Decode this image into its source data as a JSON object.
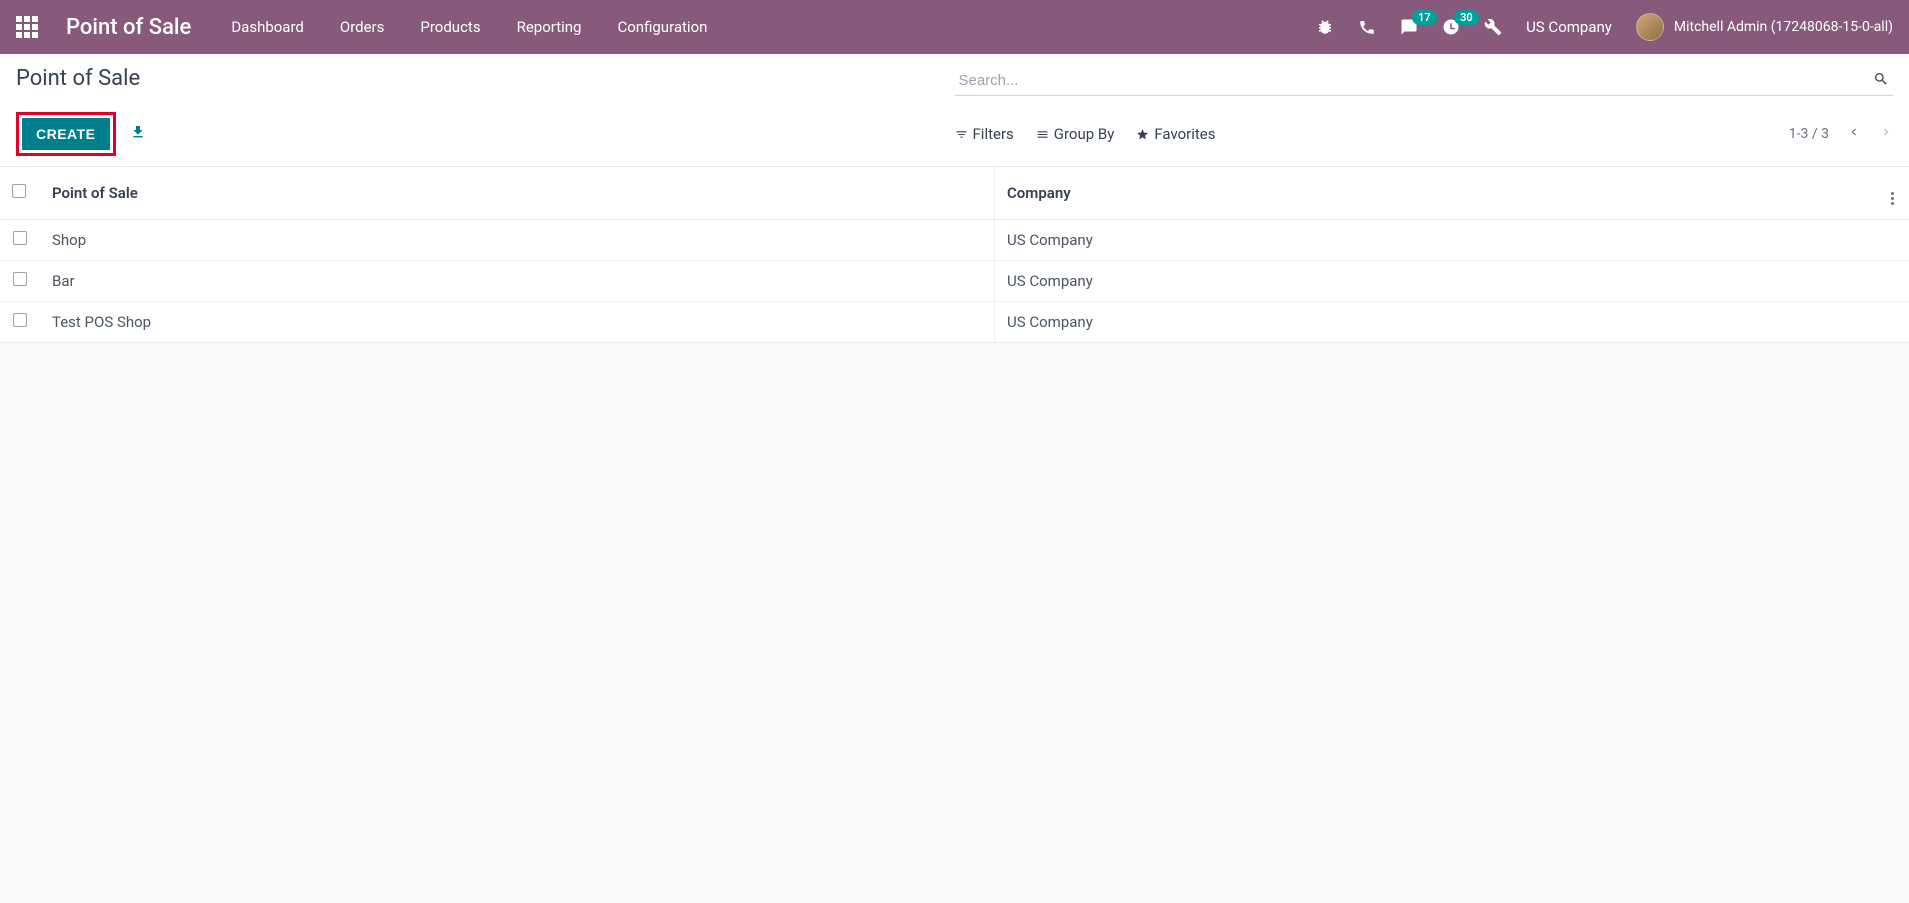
{
  "navbar": {
    "brand": "Point of Sale",
    "menu": [
      "Dashboard",
      "Orders",
      "Products",
      "Reporting",
      "Configuration"
    ],
    "messages_badge": "17",
    "activities_badge": "30",
    "company": "US Company",
    "user": "Mitchell Admin (17248068-15-0-all)"
  },
  "control": {
    "title": "Point of Sale",
    "create_label": "CREATE",
    "search_placeholder": "Search...",
    "filters_label": "Filters",
    "groupby_label": "Group By",
    "favorites_label": "Favorites",
    "pager": "1-3 / 3"
  },
  "table": {
    "col_name": "Point of Sale",
    "col_company": "Company",
    "rows": [
      {
        "name": "Shop",
        "company": "US Company"
      },
      {
        "name": "Bar",
        "company": "US Company"
      },
      {
        "name": "Test POS Shop",
        "company": "US Company"
      }
    ]
  }
}
